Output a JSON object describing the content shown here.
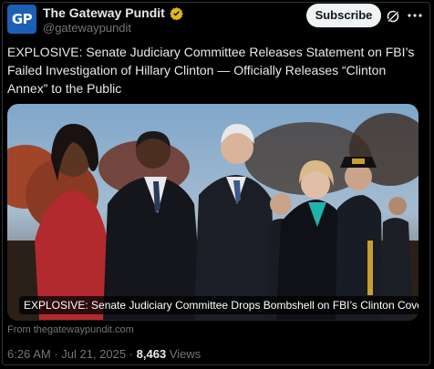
{
  "account": {
    "avatar_text": "GP",
    "name": "The Gateway Pundit",
    "handle": "@gatewaypundit",
    "verified_color": "#e2b719"
  },
  "header": {
    "subscribe_label": "Subscribe"
  },
  "tweet": {
    "text": "EXPLOSIVE: Senate Judiciary Committee Releases Statement on FBI’s Failed Investigation of Hillary Clinton — Officially Releases “Clinton Annex” to the Public"
  },
  "card": {
    "caption": "EXPLOSIVE: Senate Judiciary Committee Drops Bombshell on FBI’s Clinton Cover-Up ...",
    "source": "From thegatewaypundit.com"
  },
  "meta": {
    "time": "6:26 AM",
    "separator": " · ",
    "date": "Jul 21, 2025",
    "views_count": "8,463",
    "views_label": "Views"
  },
  "colors": {
    "accent": "#1d9bf0",
    "muted": "#71767b",
    "text": "#e7e9ea"
  }
}
